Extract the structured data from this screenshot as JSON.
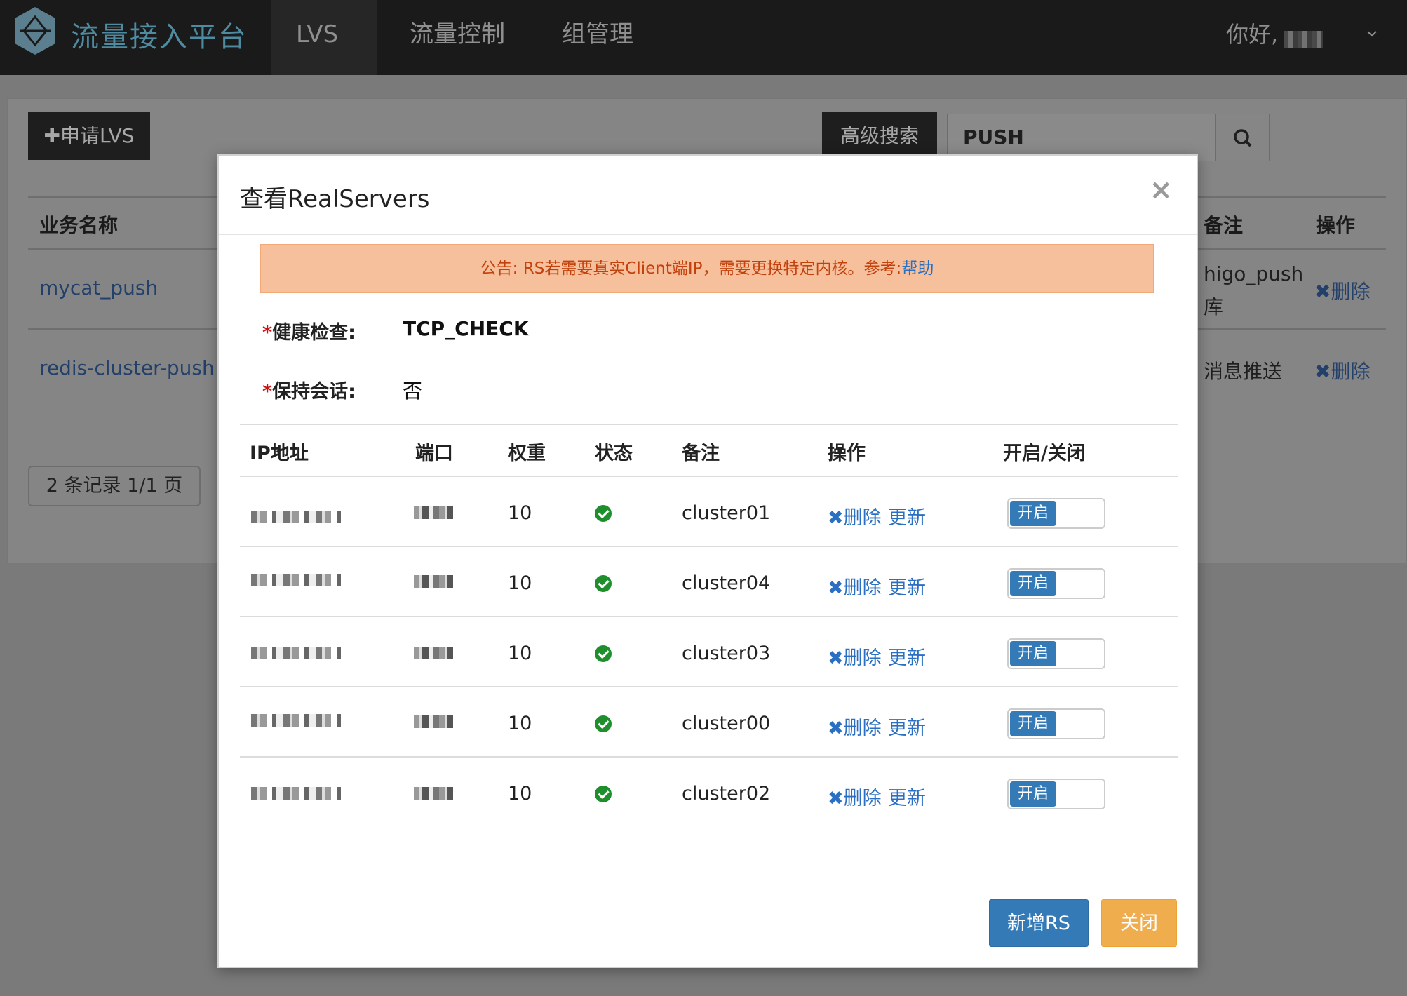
{
  "nav": {
    "brand": "流量接入平台",
    "items": [
      "LVS",
      "流量控制",
      "组管理"
    ],
    "greeting": "你好,"
  },
  "toolbar": {
    "apply_label": "✚申请LVS",
    "advanced_search_label": "高级搜索",
    "search_value": "PUSH"
  },
  "background_table": {
    "headers": {
      "name": "业务名称",
      "remark": "备注",
      "action": "操作"
    },
    "rows": [
      {
        "name": "mycat_push",
        "remark_line1": "higo_push",
        "remark_line2": "库",
        "delete": "✖删除"
      },
      {
        "name": "redis-cluster-push",
        "remark_line1": "消息推送",
        "remark_line2": "",
        "delete": "✖删除"
      }
    ],
    "pager": "2 条记录 1/1 页"
  },
  "modal": {
    "title": "查看RealServers",
    "close_glyph": "×",
    "notice_text": "公告: RS若需要真实Client端IP，需要更换特定内核。参考:",
    "notice_link": "帮助",
    "health_check_label": "健康检查:",
    "health_check_value": "TCP_CHECK",
    "session_label": "保持会话:",
    "session_value": "否",
    "required_mark": "*",
    "columns": [
      "IP地址",
      "端口",
      "权重",
      "状态",
      "备注",
      "操作",
      "开启/关闭"
    ],
    "rows": [
      {
        "weight": "10",
        "remark": "cluster01",
        "delete": "✖删除",
        "update": "更新",
        "toggle": "开启"
      },
      {
        "weight": "10",
        "remark": "cluster04",
        "delete": "✖删除",
        "update": "更新",
        "toggle": "开启"
      },
      {
        "weight": "10",
        "remark": "cluster03",
        "delete": "✖删除",
        "update": "更新",
        "toggle": "开启"
      },
      {
        "weight": "10",
        "remark": "cluster00",
        "delete": "✖删除",
        "update": "更新",
        "toggle": "开启"
      },
      {
        "weight": "10",
        "remark": "cluster02",
        "delete": "✖删除",
        "update": "更新",
        "toggle": "开启"
      }
    ],
    "add_button": "新增RS",
    "close_button": "关闭"
  }
}
